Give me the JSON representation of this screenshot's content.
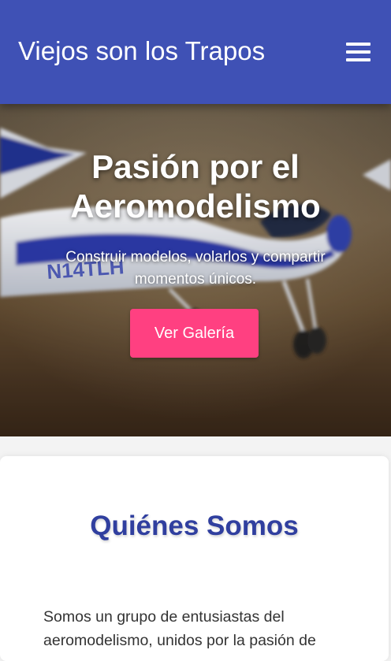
{
  "header": {
    "site_title": "Viejos son los Trapos",
    "menu_icon": "hamburger-menu-icon",
    "background_color": "#3f51b5"
  },
  "hero": {
    "title": "Pasión por el Aeromodelismo",
    "subtitle": "Construir modelos, volarlos y compartir momentos únicos.",
    "button_label": "Ver Galería",
    "button_color": "#ff4081",
    "background_image": "rc-airplane-photo",
    "plane_marking": "N14TLH"
  },
  "about": {
    "title": "Quiénes Somos",
    "title_color": "#303f9f",
    "text": "Somos un grupo de entusiastas del aeromodelismo, unidos por la pasión de"
  }
}
